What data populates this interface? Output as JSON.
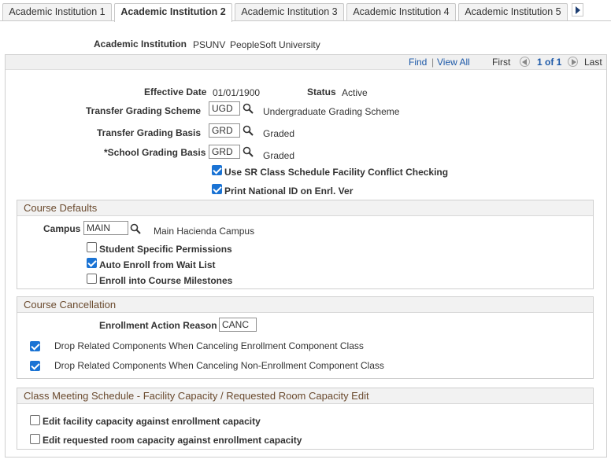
{
  "tabs": [
    {
      "label": "Academic Institution 1",
      "active": false
    },
    {
      "label": "Academic Institution 2",
      "active": true
    },
    {
      "label": "Academic Institution 3",
      "active": false
    },
    {
      "label": "Academic Institution 4",
      "active": false
    },
    {
      "label": "Academic Institution 5",
      "active": false
    }
  ],
  "header": {
    "institution_label": "Academic Institution",
    "institution_code": "PSUNV",
    "institution_name": "PeopleSoft University"
  },
  "nav": {
    "find": "Find",
    "separator": "|",
    "view_all": "View All",
    "first": "First",
    "count": "1 of 1",
    "last": "Last"
  },
  "fields": {
    "effective_date_label": "Effective Date",
    "effective_date": "01/01/1900",
    "status_label": "Status",
    "status": "Active",
    "transfer_scheme_label": "Transfer Grading Scheme",
    "transfer_scheme_value": "UGD",
    "transfer_scheme_desc": "Undergraduate Grading Scheme",
    "transfer_basis_label": "Transfer Grading Basis",
    "transfer_basis_value": "GRD",
    "transfer_basis_desc": "Graded",
    "school_basis_label": "*School Grading Basis",
    "school_basis_value": "GRD",
    "school_basis_desc": "Graded",
    "facility_conflict_label": "Use SR Class Schedule Facility Conflict Checking",
    "facility_conflict_checked": true,
    "print_national_id_label": "Print National ID on Enrl. Ver",
    "print_national_id_checked": true
  },
  "course_defaults": {
    "title": "Course Defaults",
    "campus_label": "Campus",
    "campus_value": "MAIN",
    "campus_desc": "Main Hacienda Campus",
    "student_permissions_label": "Student Specific Permissions",
    "student_permissions_checked": false,
    "auto_enroll_label": "Auto Enroll from Wait List",
    "auto_enroll_checked": true,
    "milestones_label": "Enroll into Course Milestones",
    "milestones_checked": false
  },
  "course_cancellation": {
    "title": "Course Cancellation",
    "reason_label": "Enrollment Action Reason",
    "reason_value": "CANC",
    "drop_enrollment_label": "Drop Related Components When Canceling Enrollment Component Class",
    "drop_enrollment_checked": true,
    "drop_non_enrollment_label": "Drop Related Components When Canceling Non-Enrollment Component Class",
    "drop_non_enrollment_checked": true
  },
  "meeting_schedule": {
    "title": "Class Meeting Schedule - Facility Capacity / Requested Room Capacity Edit",
    "facility_capacity_label": "Edit facility capacity against enrollment capacity",
    "facility_capacity_checked": false,
    "room_capacity_label": "Edit requested room capacity against enrollment capacity",
    "room_capacity_checked": false
  },
  "colors": {
    "link": "#1d59a8",
    "checkbox_on": "#1a73d4",
    "group_title": "#6a4a2e"
  }
}
